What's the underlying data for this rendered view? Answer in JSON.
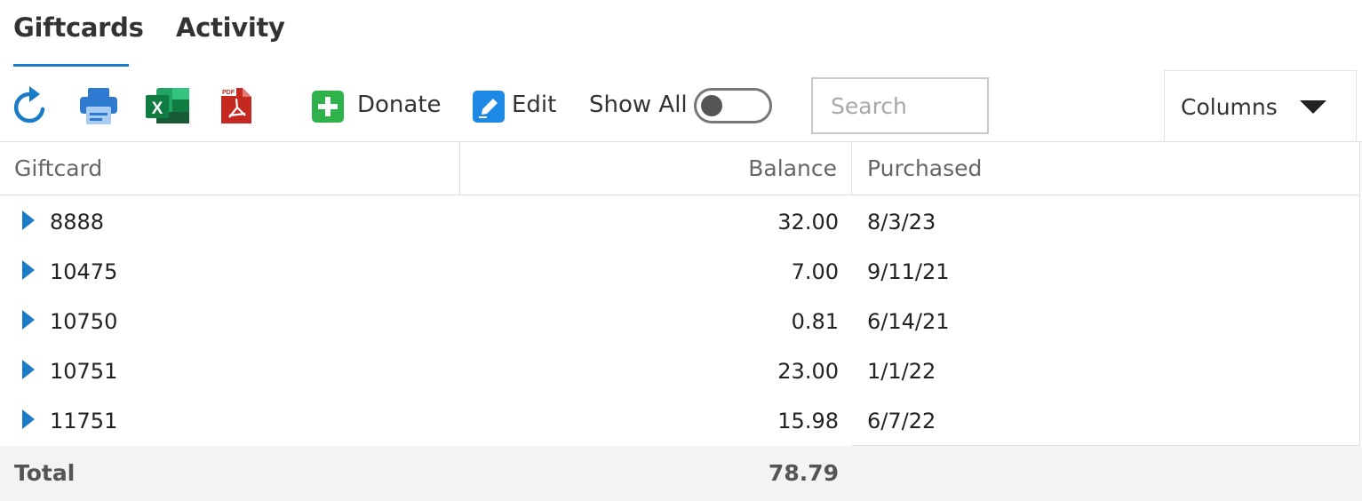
{
  "tabs": [
    {
      "label": "Giftcards",
      "active": true
    },
    {
      "label": "Activity",
      "active": false
    }
  ],
  "toolbar": {
    "icons": [
      "refresh-icon",
      "print-icon",
      "excel-icon",
      "pdf-icon"
    ],
    "pdf_icon_text": "PDF",
    "excel_icon_text": "X",
    "donate_label": "Donate",
    "edit_label": "Edit",
    "show_all_label": "Show All",
    "show_all_on": false,
    "search_placeholder": "Search",
    "columns_label": "Columns"
  },
  "colors": {
    "accent": "#1a7bc8",
    "donate_green": "#2db34a",
    "excel_green": "#1d6f42",
    "pdf_red": "#b4231f"
  },
  "grid": {
    "headers": [
      "Giftcard",
      "Balance",
      "Purchased"
    ],
    "rows": [
      {
        "giftcard": "8888",
        "balance": "32.00",
        "purchased": "8/3/23"
      },
      {
        "giftcard": "10475",
        "balance": "7.00",
        "purchased": "9/11/21"
      },
      {
        "giftcard": "10750",
        "balance": "0.81",
        "purchased": "6/14/21"
      },
      {
        "giftcard": "10751",
        "balance": "23.00",
        "purchased": "1/1/22"
      },
      {
        "giftcard": "11751",
        "balance": "15.98",
        "purchased": "6/7/22"
      }
    ],
    "footer": {
      "label": "Total",
      "balance": "78.79"
    }
  }
}
